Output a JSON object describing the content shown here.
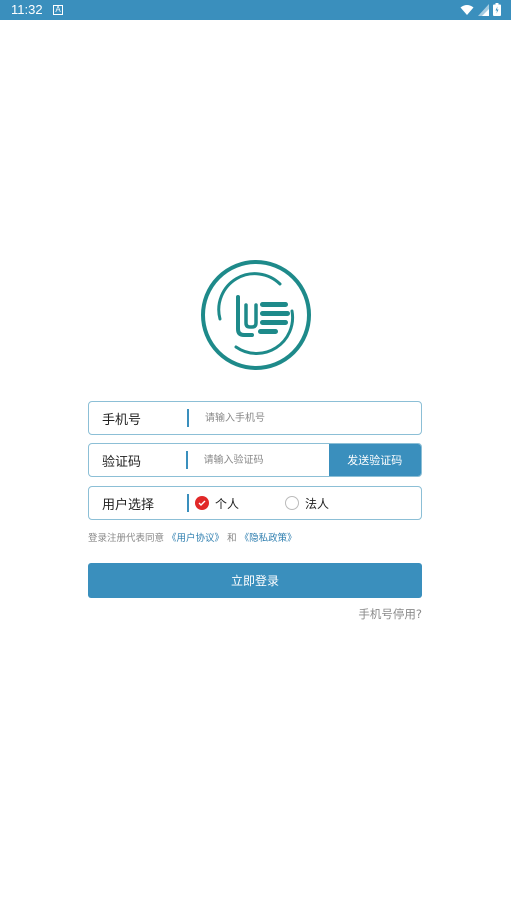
{
  "status_bar": {
    "time": "11:32",
    "notification_icon_letter": "A",
    "icons": [
      "wifi-icon",
      "signal-icon",
      "battery-icon"
    ]
  },
  "logo": {
    "icon": "app-logo-icon",
    "color": "#1e8a8a"
  },
  "phone_field": {
    "label": "手机号",
    "placeholder": "请输入手机号",
    "value": ""
  },
  "code_field": {
    "label": "验证码",
    "placeholder": "请输入验证码",
    "value": "",
    "send_button": "发送验证码"
  },
  "user_type": {
    "label": "用户选择",
    "options": [
      {
        "label": "个人",
        "selected": true
      },
      {
        "label": "法人",
        "selected": false
      }
    ]
  },
  "agreement": {
    "prefix": "登录注册代表同意",
    "user_agreement": "《用户协议》",
    "and": "和",
    "privacy_policy": "《隐私政策》"
  },
  "login_button": "立即登录",
  "phone_disabled_link": "手机号停用?",
  "colors": {
    "primary": "#3a8fbd",
    "check": "#e12828",
    "logo": "#1e8a8a"
  }
}
